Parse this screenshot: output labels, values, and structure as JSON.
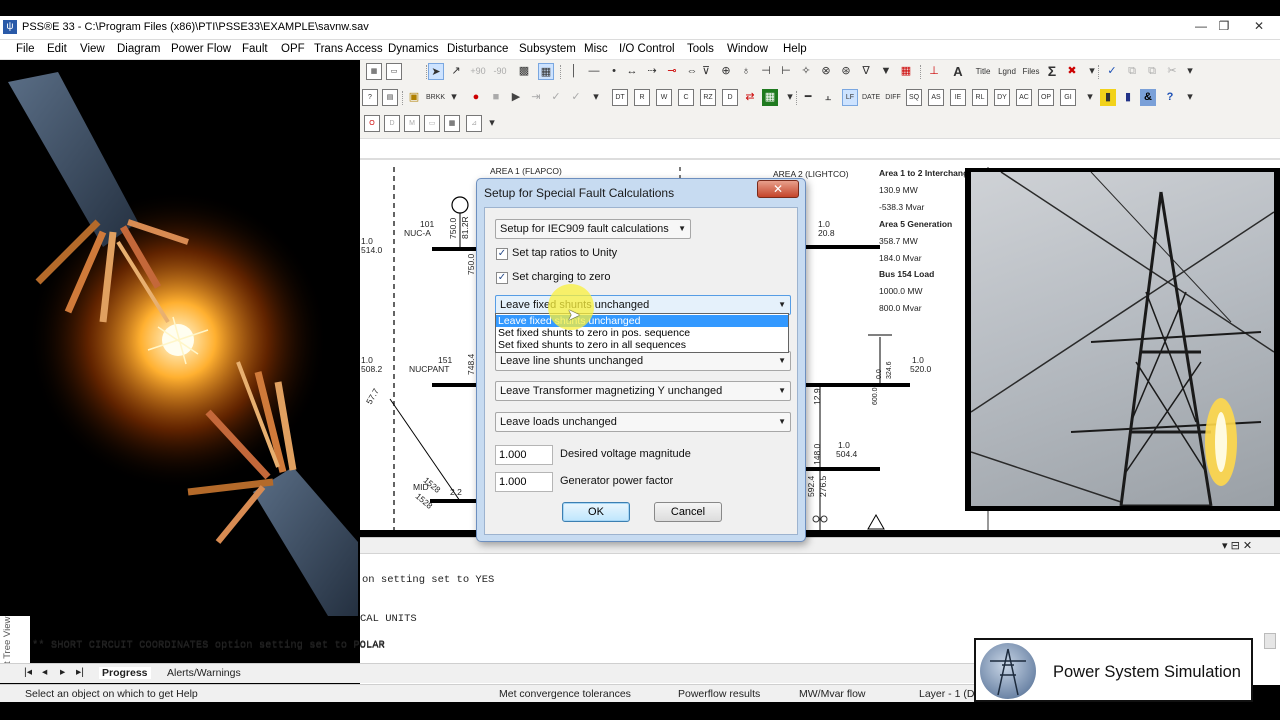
{
  "window": {
    "title": "PSS®E 33 - C:\\Program Files (x86)\\PTI\\PSSE33\\EXAMPLE\\savnw.sav",
    "minimize": "—",
    "maximize": "❐",
    "close": "✕"
  },
  "menu": [
    "File",
    "Edit",
    "View",
    "Diagram",
    "Power Flow",
    "Fault",
    "OPF",
    "Trans Access",
    "Dynamics",
    "Disturbance",
    "Subsystem",
    "Misc",
    "I/O Control",
    "Tools",
    "Window",
    "Help"
  ],
  "toolbar": {
    "labels": [
      "+90",
      "-90",
      "Title",
      "Lgnd",
      "Files",
      "Σ",
      "DATE",
      "DIFF",
      "BRKK"
    ]
  },
  "diagram": {
    "area1": "AREA 1 (FLAPCO)",
    "area2": "AREA 2 (LIGHTCO)",
    "bus101_num": "101",
    "bus101_name": "NUC-A",
    "bus101_v": "1.0",
    "bus101_a": "514.0",
    "bus101_p": "750.0",
    "bus101_q": "81.2R",
    "bus101_flow": "750.0",
    "bus151_num": "151",
    "bus151_name": "NUCPANT",
    "bus151_v": "1.0",
    "bus151_a": "508.2",
    "bus151_flow": "748.4",
    "mid_name": "MID",
    "mid_a": "1528",
    "mid_b": "2.2",
    "mid_c": "1528",
    "mid_d": "57.7",
    "right_v1": "1.0",
    "right_a1": "20.8",
    "right_v2": "1.0",
    "right_a2": "520.0",
    "right_v3": "1.0",
    "right_a3": "504.4",
    "vals": [
      "0.0",
      "600.0",
      "12.9",
      "148.0",
      "592.4",
      "276.5",
      "324.6"
    ],
    "interchange_title": "Area 1 to 2 Interchange",
    "interchange_mw": "130.9 MW",
    "interchange_mvar": "-538.3 Mvar",
    "gen_title": "Area 5 Generation",
    "gen_mw": "358.7 MW",
    "gen_mvar": "184.0 Mvar",
    "load_title": "Bus 154 Load",
    "load_mw": "1000.0 MW",
    "load_mvar": "800.0 Mvar"
  },
  "dialog": {
    "title": "Setup for Special Fault Calculations",
    "close": "✕",
    "fault_mode": "Setup for IEC909 fault calculations",
    "chk_tap_label": "Set tap ratios to Unity",
    "chk_tap_checked": "✓",
    "chk_charging_label": "Set charging to zero",
    "chk_charging_checked": "✓",
    "fixed_shunts": "Leave fixed shunts unchanged",
    "fixed_shunts_options": [
      "Leave fixed shunts unchanged",
      "Set fixed shunts to zero in pos. sequence",
      "Set fixed shunts to zero in all sequences"
    ],
    "line_shunts": "Leave line shunts unchanged",
    "transformer": "Leave Transformer magnetizing Y unchanged",
    "loads": "Leave loads unchanged",
    "voltage_value": "1.000",
    "voltage_label": "Desired voltage magnitude",
    "pf_value": "1.000",
    "pf_label": "Generator power factor",
    "ok": "OK",
    "cancel": "Cancel",
    "arrow": "▼"
  },
  "output": {
    "lines": [
      "on setting set to YES",
      "CAL UNITS",
      "** SHORT CIRCUIT COORDINATES option setting set to POLAR"
    ],
    "panel_ctrl": "▾ ⊟ ✕"
  },
  "tabs": {
    "nav": [
      "|◂",
      "◂",
      "▸",
      "▸|"
    ],
    "progress": "Progress",
    "alerts": "Alerts/Warnings",
    "side_label": "t Tree View"
  },
  "status": {
    "hint": "Select an object on which to get Help",
    "convergence": "Met convergence tolerances",
    "pf": "Powerflow results",
    "units": "MW/Mvar flow",
    "layer": "Layer - 1 (D"
  },
  "logo": {
    "text": "Power System Simulation"
  },
  "colors": {
    "dialog_bg": "#c7dbf1",
    "highlight": "#3399ff",
    "close_red": "#c4442a"
  }
}
